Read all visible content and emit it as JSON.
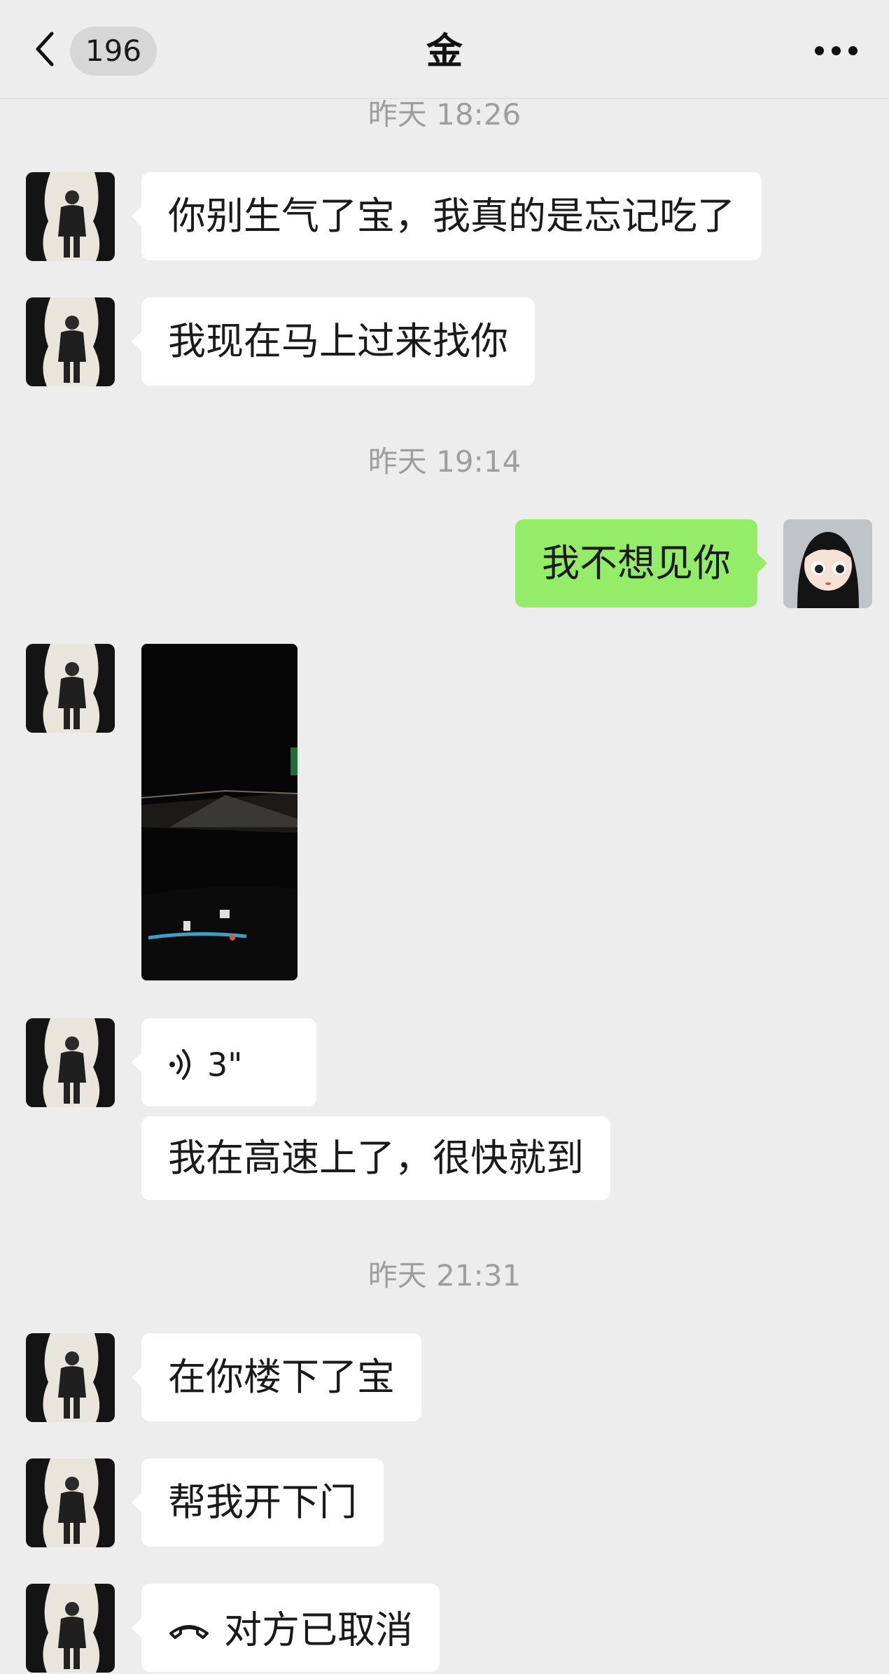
{
  "header": {
    "back_icon": "chevron-left-icon",
    "unread_count": "196",
    "title": "金",
    "more_icon": "ellipsis-icon"
  },
  "timestamps": [
    "昨天 18:26",
    "昨天 19:14",
    "昨天 21:31"
  ],
  "messages": [
    {
      "from": "other",
      "type": "text",
      "text": "你别生气了宝，我真的是忘记吃了"
    },
    {
      "from": "other",
      "type": "text",
      "text": "我现在马上过来找你"
    },
    {
      "from": "me",
      "type": "text",
      "text": "我不想见你"
    },
    {
      "from": "other",
      "type": "video",
      "description_icon": "night-highway-video-thumbnail"
    },
    {
      "from": "other",
      "type": "voice",
      "duration": "3\"",
      "icon": "voice-wave-icon"
    },
    {
      "from": "other",
      "type": "text",
      "text": "我在高速上了，很快就到"
    },
    {
      "from": "other",
      "type": "text",
      "text": "在你楼下了宝"
    },
    {
      "from": "other",
      "type": "text",
      "text": "帮我开下门"
    },
    {
      "from": "other",
      "type": "call",
      "text": "对方已取消",
      "icon": "phone-hangup-icon"
    }
  ],
  "colors": {
    "background": "#ededed",
    "my_bubble": "#95ec69",
    "other_bubble": "#ffffff",
    "timestamp": "#9e9e9e"
  }
}
